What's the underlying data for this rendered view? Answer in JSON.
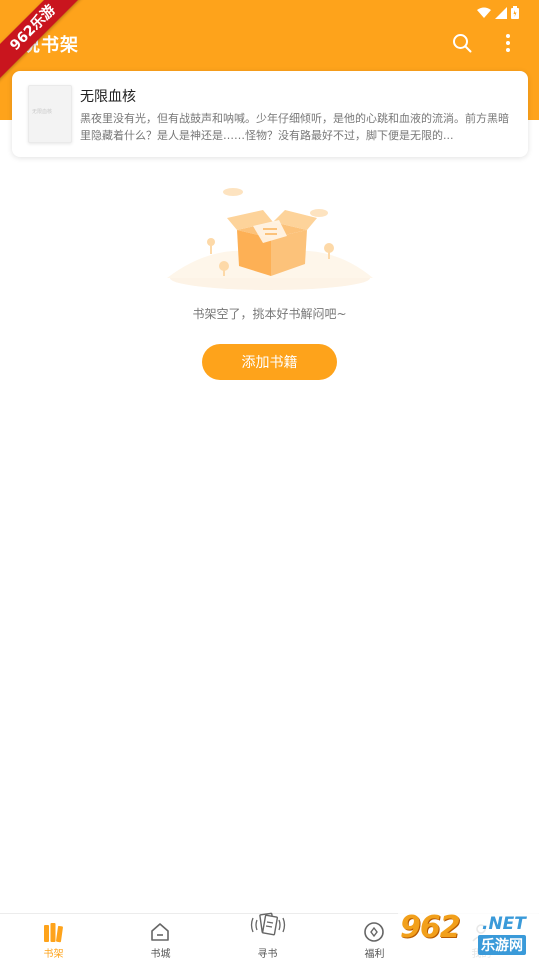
{
  "app": {
    "title": "说书架",
    "accent_color": "#fea31b"
  },
  "status_bar": {
    "icons": [
      "wifi-icon",
      "signal-icon",
      "battery-icon"
    ]
  },
  "ribbon": {
    "label": "962乐游"
  },
  "header": {
    "actions": [
      {
        "name": "search-icon"
      },
      {
        "name": "more-vertical-icon"
      }
    ]
  },
  "book": {
    "title": "无限血核",
    "cover_text": "无限血核",
    "description": "黑夜里没有光，但有战鼓声和呐喊。少年仔细倾听，是他的心跳和血液的流淌。前方黑暗里隐藏着什么？是人是神还是……怪物？没有路最好不过，脚下便是无限的..."
  },
  "empty_state": {
    "message": "书架空了，挑本好书解闷吧~",
    "button_label": "添加书籍"
  },
  "bottom_nav": {
    "items": [
      {
        "label": "书架",
        "icon": "bookshelf-icon",
        "active": true
      },
      {
        "label": "书城",
        "icon": "home-icon",
        "active": false
      },
      {
        "label": "寻书",
        "icon": "find-book-icon",
        "active": false
      },
      {
        "label": "福利",
        "icon": "coin-icon",
        "active": false
      },
      {
        "label": "我的",
        "icon": "user-icon",
        "active": false
      }
    ]
  },
  "watermark": {
    "number": "962",
    "domain": ".NET",
    "cn": "乐游网"
  }
}
